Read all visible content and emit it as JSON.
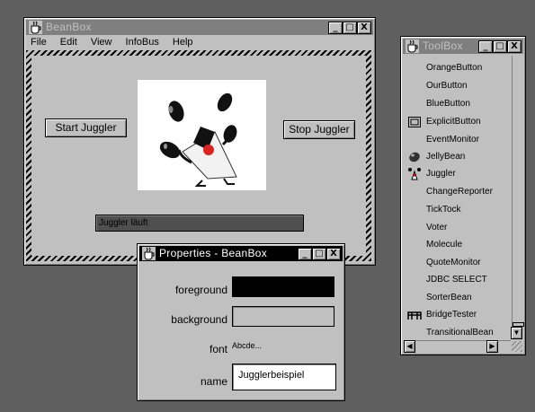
{
  "beanbox": {
    "title": "BeanBox",
    "menu": [
      "File",
      "Edit",
      "View",
      "InfoBus",
      "Help"
    ],
    "start_button": "Start Juggler",
    "stop_button": "Stop Juggler",
    "status_text": "Juggler läuft"
  },
  "toolbox": {
    "title": "ToolBox",
    "items": [
      {
        "label": "OrangeButton",
        "icon": ""
      },
      {
        "label": "OurButton",
        "icon": ""
      },
      {
        "label": "BlueButton",
        "icon": ""
      },
      {
        "label": "ExplicitButton",
        "icon": "explicit-button-icon"
      },
      {
        "label": "EventMonitor",
        "icon": ""
      },
      {
        "label": "JellyBean",
        "icon": "jellybean-icon"
      },
      {
        "label": "Juggler",
        "icon": "juggler-icon"
      },
      {
        "label": "ChangeReporter",
        "icon": ""
      },
      {
        "label": "TickTock",
        "icon": ""
      },
      {
        "label": "Voter",
        "icon": ""
      },
      {
        "label": "Molecule",
        "icon": ""
      },
      {
        "label": "QuoteMonitor",
        "icon": ""
      },
      {
        "label": "JDBC SELECT",
        "icon": ""
      },
      {
        "label": "SorterBean",
        "icon": ""
      },
      {
        "label": "BridgeTester",
        "icon": "bridgetester-icon"
      },
      {
        "label": "TransitionalBean",
        "icon": ""
      }
    ]
  },
  "properties": {
    "title": "Properties - BeanBox",
    "foreground_label": "foreground",
    "foreground_color": "#000000",
    "background_label": "background",
    "background_color": "#c0c0c0",
    "font_label": "font",
    "font_value": "Abcde...",
    "name_label": "name",
    "name_value": "Jugglerbeispiel"
  },
  "window_controls": {
    "minimize": "_",
    "maximize": "□",
    "close": "X"
  }
}
